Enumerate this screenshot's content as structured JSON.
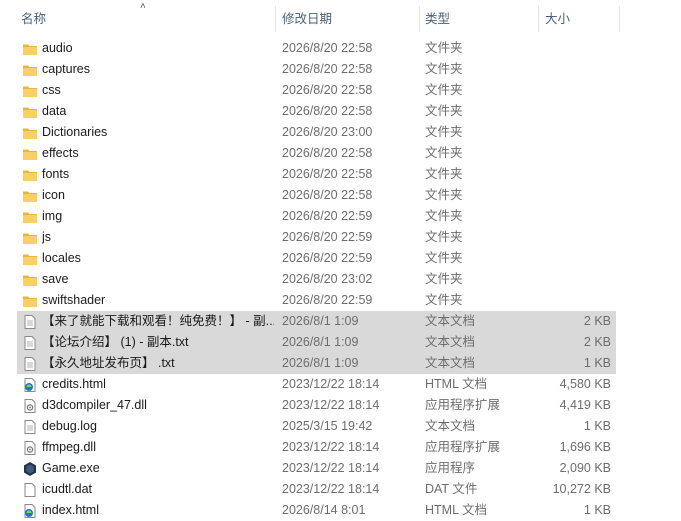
{
  "columns": {
    "name": "名称",
    "date": "修改日期",
    "type": "类型",
    "size": "大小"
  },
  "rows": [
    {
      "name": "audio",
      "date": "2026/8/20 22:58",
      "type": "文件夹",
      "size": "",
      "icon": "folder-icon",
      "selected": false
    },
    {
      "name": "captures",
      "date": "2026/8/20 22:58",
      "type": "文件夹",
      "size": "",
      "icon": "folder-icon",
      "selected": false
    },
    {
      "name": "css",
      "date": "2026/8/20 22:58",
      "type": "文件夹",
      "size": "",
      "icon": "folder-icon",
      "selected": false
    },
    {
      "name": "data",
      "date": "2026/8/20 22:58",
      "type": "文件夹",
      "size": "",
      "icon": "folder-icon",
      "selected": false
    },
    {
      "name": "Dictionaries",
      "date": "2026/8/20 23:00",
      "type": "文件夹",
      "size": "",
      "icon": "folder-icon",
      "selected": false
    },
    {
      "name": "effects",
      "date": "2026/8/20 22:58",
      "type": "文件夹",
      "size": "",
      "icon": "folder-icon",
      "selected": false
    },
    {
      "name": "fonts",
      "date": "2026/8/20 22:58",
      "type": "文件夹",
      "size": "",
      "icon": "folder-icon",
      "selected": false
    },
    {
      "name": "icon",
      "date": "2026/8/20 22:58",
      "type": "文件夹",
      "size": "",
      "icon": "folder-icon",
      "selected": false
    },
    {
      "name": "img",
      "date": "2026/8/20 22:59",
      "type": "文件夹",
      "size": "",
      "icon": "folder-icon",
      "selected": false
    },
    {
      "name": "js",
      "date": "2026/8/20 22:59",
      "type": "文件夹",
      "size": "",
      "icon": "folder-icon",
      "selected": false
    },
    {
      "name": "locales",
      "date": "2026/8/20 22:59",
      "type": "文件夹",
      "size": "",
      "icon": "folder-icon",
      "selected": false
    },
    {
      "name": "save",
      "date": "2026/8/20 23:02",
      "type": "文件夹",
      "size": "",
      "icon": "folder-icon",
      "selected": false
    },
    {
      "name": "swiftshader",
      "date": "2026/8/20 22:59",
      "type": "文件夹",
      "size": "",
      "icon": "folder-icon",
      "selected": false
    },
    {
      "name": "【来了就能下载和观看！纯免费！】 - 副...",
      "date": "2026/8/1 1:09",
      "type": "文本文档",
      "size": "2 KB",
      "icon": "text-file-icon",
      "selected": true
    },
    {
      "name": "【论坛介绍】 (1) - 副本.txt",
      "date": "2026/8/1 1:09",
      "type": "文本文档",
      "size": "2 KB",
      "icon": "text-file-icon",
      "selected": true
    },
    {
      "name": "【永久地址发布页】 .txt",
      "date": "2026/8/1 1:09",
      "type": "文本文档",
      "size": "1 KB",
      "icon": "text-file-icon",
      "selected": true
    },
    {
      "name": "credits.html",
      "date": "2023/12/22 18:14",
      "type": "HTML 文档",
      "size": "4,580 KB",
      "icon": "html-file-icon",
      "selected": false
    },
    {
      "name": "d3dcompiler_47.dll",
      "date": "2023/12/22 18:14",
      "type": "应用程序扩展",
      "size": "4,419 KB",
      "icon": "dll-file-icon",
      "selected": false
    },
    {
      "name": "debug.log",
      "date": "2025/3/15 19:42",
      "type": "文本文档",
      "size": "1 KB",
      "icon": "text-file-icon",
      "selected": false
    },
    {
      "name": "ffmpeg.dll",
      "date": "2023/12/22 18:14",
      "type": "应用程序扩展",
      "size": "1,696 KB",
      "icon": "dll-file-icon",
      "selected": false
    },
    {
      "name": "Game.exe",
      "date": "2023/12/22 18:14",
      "type": "应用程序",
      "size": "2,090 KB",
      "icon": "exe-app-icon",
      "selected": false
    },
    {
      "name": "icudtl.dat",
      "date": "2023/12/22 18:14",
      "type": "DAT 文件",
      "size": "10,272 KB",
      "icon": "blank-file-icon",
      "selected": false
    },
    {
      "name": "index.html",
      "date": "2026/8/14 8:01",
      "type": "HTML 文档",
      "size": "1 KB",
      "icon": "html-file-icon",
      "selected": false
    }
  ]
}
